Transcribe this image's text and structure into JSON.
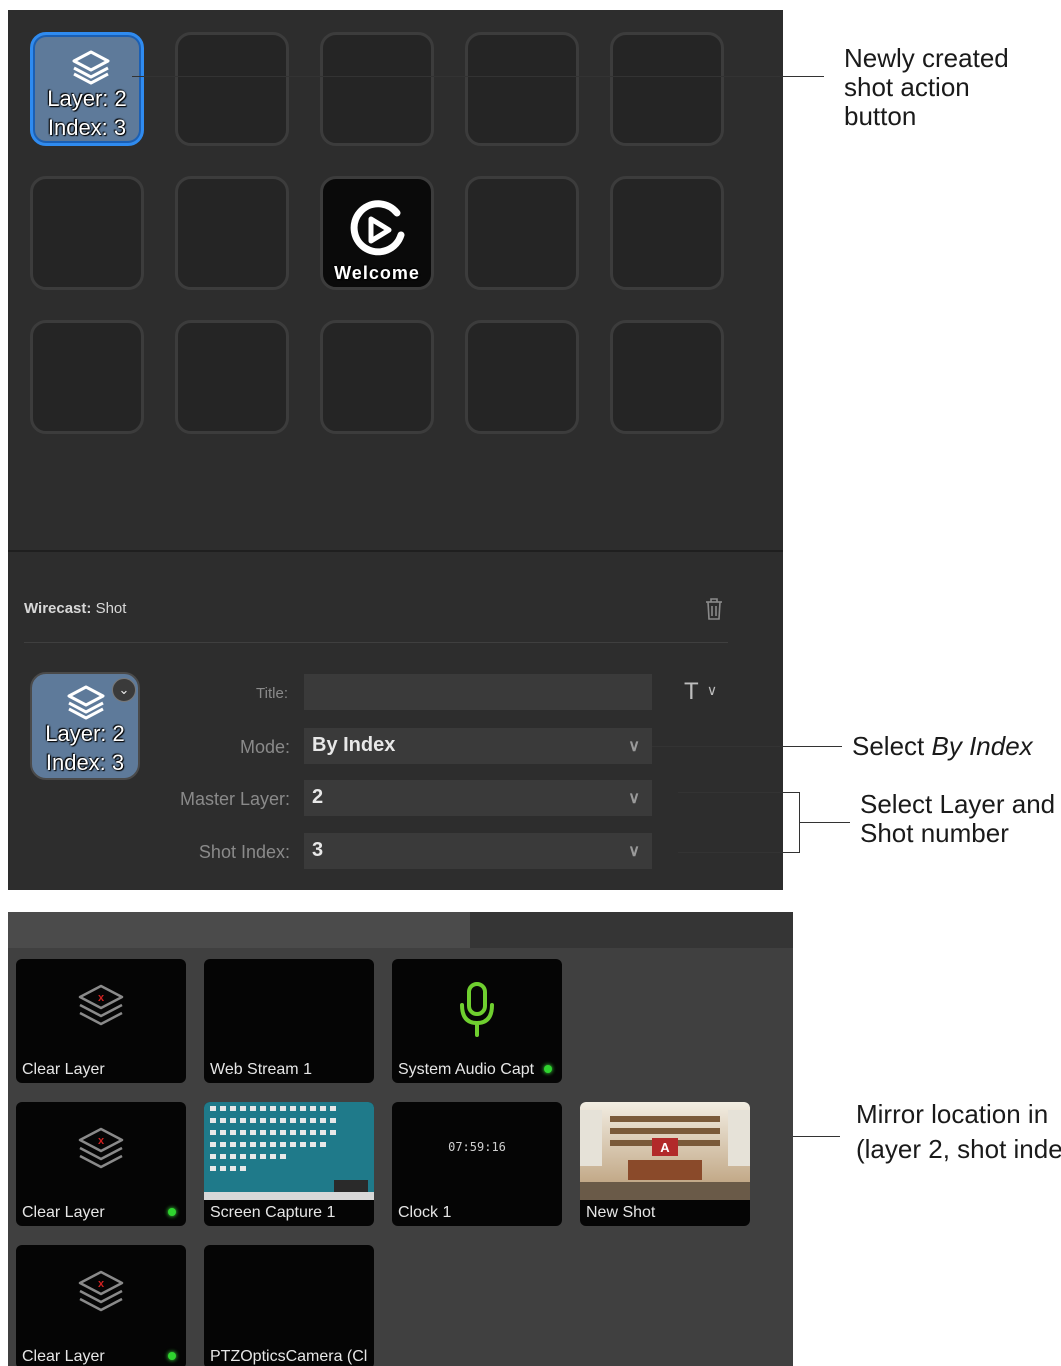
{
  "deck": {
    "new_button": {
      "line1": "Layer: 2",
      "line2": "Index: 3"
    },
    "welcome_button": {
      "label": "Welcome"
    },
    "inspector": {
      "plugin_name": "Wirecast:",
      "action_name": "Shot",
      "preview": {
        "line1": "Layer: 2",
        "line2": "Index: 3"
      },
      "title_label": "Title:",
      "title_value": "",
      "title_font_glyph": "T",
      "mode_label": "Mode:",
      "mode_value": "By Index",
      "master_layer_label": "Master Layer:",
      "master_layer_value": "2",
      "shot_index_label": "Shot Index:",
      "shot_index_value": "3"
    }
  },
  "annotations": {
    "newly_created": [
      "Newly created",
      "shot action",
      "button"
    ],
    "select_by_index_prefix": "Select ",
    "select_by_index_em": "By Index",
    "select_layer": [
      "Select Layer and",
      "Shot number"
    ],
    "mirror": [
      "Mirror location in",
      "(layer 2, shot inde"
    ]
  },
  "wirecast": {
    "rows": [
      [
        {
          "label": "Clear Layer",
          "icon": "clear-layer-icon",
          "live": false
        },
        {
          "label": "Web Stream 1",
          "icon": "none",
          "live": false
        },
        {
          "label": "System Audio Capt",
          "icon": "microphone-icon",
          "live": true
        }
      ],
      [
        {
          "label": "Clear Layer",
          "icon": "clear-layer-icon",
          "live": true
        },
        {
          "label": "Screen Capture 1",
          "icon": "screen-thumbnail",
          "live": false
        },
        {
          "label": "Clock 1",
          "icon": "clock-text",
          "clock": "07:59:16",
          "live": false
        },
        {
          "label": "New Shot",
          "icon": "studio-thumbnail",
          "live": false
        }
      ],
      [
        {
          "label": "Clear Layer",
          "icon": "clear-layer-icon",
          "live": true
        },
        {
          "label": "PTZOpticsCamera (Cl",
          "icon": "none",
          "live": false
        }
      ]
    ]
  },
  "colors": {
    "accent": "#2f8bf0",
    "live": "#2fd42f",
    "mic": "#6fcf2f"
  }
}
